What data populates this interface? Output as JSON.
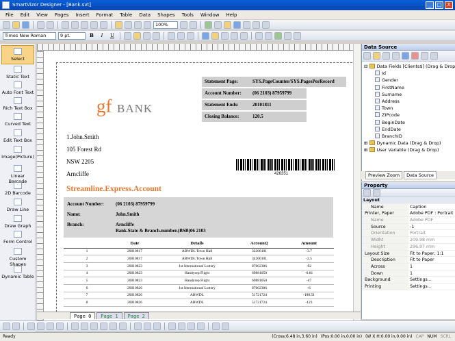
{
  "window": {
    "title": "SmartVizor Designer - [Bank.svt]",
    "controls": [
      "_",
      "□",
      "X"
    ]
  },
  "menu": [
    "File",
    "Edit",
    "View",
    "Pages",
    "Insert",
    "Format",
    "Table",
    "Data",
    "Shapes",
    "Tools",
    "Window",
    "Help"
  ],
  "toolbar": {
    "zoom": "100%",
    "font": "Times New Roman",
    "size": "9 pt."
  },
  "toolbox": [
    "Select",
    "Static Text",
    "Auto Font Text",
    "Rich Text Box",
    "Curved Text",
    "Edit Text Box",
    "Image(Picture)",
    "Linear Barcode",
    "2D Barcode",
    "Draw Line",
    "Draw Graph",
    "Form Control",
    "Custom Shapes",
    "Dynamic Table"
  ],
  "doc": {
    "logo_gf": "gf",
    "logo_bank": "BANK",
    "stmt": [
      {
        "label": "Statement Page:",
        "value": "SYS.PageCounter/SYS.PagesPerRecord"
      },
      {
        "label": "Account Number:",
        "value": "(06 2103) 87959799"
      },
      {
        "label": "Statement Ends:",
        "value": "20101811"
      },
      {
        "label": "Closing Balance:",
        "value": "120.5"
      }
    ],
    "address": [
      "1.John.Smith",
      "105 Forest Rd",
      "NSW 2205",
      "Arncliffe"
    ],
    "barcode_text": "426351",
    "heading": "Streamline.Express.Account",
    "acc_labels": [
      "Account Number:",
      "Name:",
      "Branch:"
    ],
    "acc_values": [
      "(06 2103) 87959799",
      "John.Smith",
      "Arncliffe",
      "Bank.State & Branch.number.(BSB)06 2103"
    ],
    "table": {
      "headers": [
        "Date",
        "Details",
        "Account2",
        "Amount"
      ],
      "rows": [
        [
          "1",
          "20010817",
          "ABWDL Town Hall",
          "32206101",
          "-3.7"
        ],
        [
          "2",
          "20010817",
          "ABWDL Town Hall",
          "34200101",
          "-2.5"
        ],
        [
          "3",
          "20010823",
          "1st International Lottery",
          "87602386",
          "-92"
        ],
        [
          "4",
          "20010823",
          "Handyrep Flight",
          "69881050",
          "-0.81"
        ],
        [
          "5",
          "20010823",
          "Handyrep Flight",
          "69881050",
          "-47"
        ],
        [
          "6",
          "20010826",
          "1st International Lottery",
          "87602386",
          "-6"
        ],
        [
          "7",
          "20010826",
          "ABWDL",
          "51721724",
          "-180.51"
        ],
        [
          "8",
          "20010826",
          "ABWDL",
          "51721724",
          "-123"
        ]
      ]
    }
  },
  "pagetabs": [
    "Page 0",
    "Page 1",
    "Page 2"
  ],
  "datasource": {
    "title": "Data Source",
    "tree": [
      "Data Fields [Clients$] (Drag & Drop)",
      "Id",
      "Gender",
      "FirstName",
      "Surname",
      "Address",
      "Town",
      "ZIPcode",
      "BeginDate",
      "EndDate",
      "BranchID",
      "Dynamic Data (Drag & Drop)",
      "User Variable (Drag & Drop)"
    ],
    "tabs": [
      "Preview Zoom",
      "Data Source"
    ]
  },
  "property": {
    "title": "Property",
    "rows": [
      {
        "k": "Layout",
        "v": "",
        "t": "cat"
      },
      {
        "k": "Name",
        "v": "Caption",
        "t": "ind"
      },
      {
        "k": "Printer, Paper",
        "v": "Adobe PDF : Portrait",
        "t": "grp"
      },
      {
        "k": "Name",
        "v": "Adobe PDF",
        "t": "dim"
      },
      {
        "k": "Source",
        "v": "-1",
        "t": "ind"
      },
      {
        "k": "Orientation",
        "v": "Portrait",
        "t": "dim"
      },
      {
        "k": "Widht",
        "v": "209.98 mm",
        "t": "dim"
      },
      {
        "k": "Height",
        "v": "296.97 mm",
        "t": "dim"
      },
      {
        "k": "Layout Size",
        "v": "Fit to Paper, 1:1",
        "t": "grp"
      },
      {
        "k": "Description",
        "v": "Fit to Paper",
        "t": "ind"
      },
      {
        "k": "Across",
        "v": "1",
        "t": "ind"
      },
      {
        "k": "Down",
        "v": "1",
        "t": "ind"
      },
      {
        "k": "Background",
        "v": "Settings...",
        "t": "grp"
      },
      {
        "k": "Printing",
        "v": "Settings...",
        "t": "grp"
      }
    ]
  },
  "status": {
    "left": "Ready",
    "cross": "(Cross:6.48 in,3.60 in)",
    "pos": "(Pos:0.00 in,0.00 in)",
    "wh": "(W X H:0.00 in,0.00 in)",
    "cap": "CAP",
    "num": "NUM",
    "scrl": "SCRL"
  },
  "colors": {
    "heading": "#e8772e",
    "logo": "#e8772e",
    "graybox": "#cfcfcf"
  }
}
